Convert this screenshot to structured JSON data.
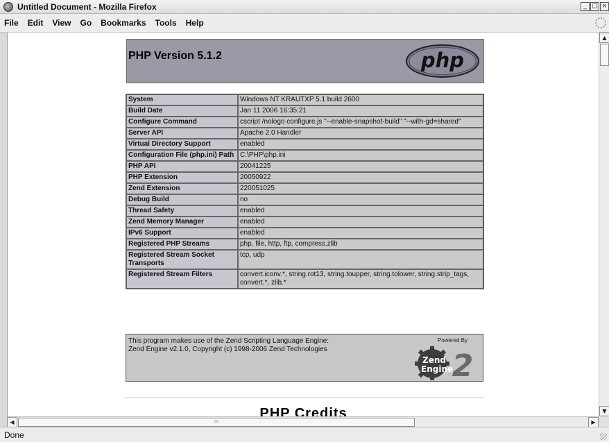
{
  "window": {
    "title": "Untitled Document - Mozilla Firefox",
    "controls": [
      "_",
      "□",
      "×"
    ]
  },
  "menu": [
    "File",
    "Edit",
    "View",
    "Go",
    "Bookmarks",
    "Tools",
    "Help"
  ],
  "page": {
    "version_heading": "PHP Version 5.1.2",
    "logo_text": "php",
    "rows": [
      {
        "key": "System",
        "value": "Windows NT KRAUTXP 5.1 build 2600"
      },
      {
        "key": "Build Date",
        "value": "Jan 11 2006 16:35:21"
      },
      {
        "key": "Configure Command",
        "value": "cscript /nologo configure.js \"--enable-snapshot-build\" \"--with-gd=shared\""
      },
      {
        "key": "Server API",
        "value": "Apache 2.0 Handler"
      },
      {
        "key": "Virtual Directory Support",
        "value": "enabled"
      },
      {
        "key": "Configuration File (php.ini) Path",
        "value": "C:\\PHP\\php.ini"
      },
      {
        "key": "PHP API",
        "value": "20041225"
      },
      {
        "key": "PHP Extension",
        "value": "20050922"
      },
      {
        "key": "Zend Extension",
        "value": "220051025"
      },
      {
        "key": "Debug Build",
        "value": "no"
      },
      {
        "key": "Thread Safety",
        "value": "enabled"
      },
      {
        "key": "Zend Memory Manager",
        "value": "enabled"
      },
      {
        "key": "IPv6 Support",
        "value": "enabled"
      },
      {
        "key": "Registered PHP Streams",
        "value": "php, file, http, ftp, compress.zlib"
      },
      {
        "key": "Registered Stream Socket Transports",
        "value": "tcp, udp"
      },
      {
        "key": "Registered Stream Filters",
        "value": "convert.iconv.*, string.rot13, string.toupper, string.tolower, string.strip_tags, convert.*, zlib.*"
      }
    ],
    "zend": {
      "line1": "This program makes use of the Zend Scripting Language Engine:",
      "line2": "Zend Engine v2.1.0, Copyright (c) 1998-2006 Zend Technologies",
      "powered_by": "Powered By",
      "logo_line1": "Zend",
      "logo_line2": "Engine",
      "logo_num": "2"
    },
    "credits_title": "PHP Credits"
  },
  "scrollbars": {
    "up": "▲",
    "down": "▼",
    "left": "◀",
    "right": "▶",
    "thumb_grip": "III"
  },
  "status": "Done"
}
